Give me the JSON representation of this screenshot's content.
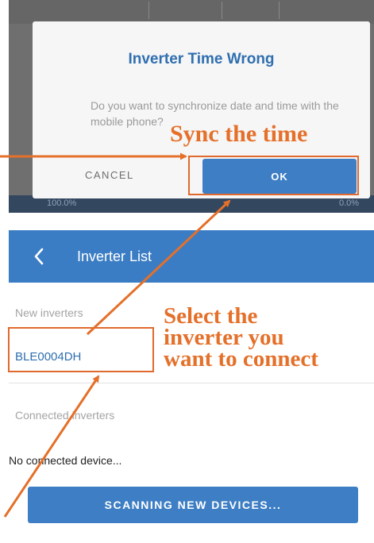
{
  "dialog": {
    "title": "Inverter Time Wrong",
    "message": "Do you want to synchronize date and time with the mobile phone?",
    "cancel_label": "CANCEL",
    "ok_label": "OK",
    "background_left": "100.0%",
    "background_right": "0.0%"
  },
  "inverter_list": {
    "title": "Inverter List",
    "new_section_label": "New inverters",
    "new_devices": [
      "BLE0004DH"
    ],
    "connected_section_label": "Connected inverters",
    "connected_empty_text": "No connected device...",
    "scan_button_label": "SCANNING NEW DEVICES..."
  },
  "annotations": {
    "sync_callout": "Sync the time",
    "select_callout": "Select the\ninverter you\nwant to connect"
  },
  "colors": {
    "accent_blue": "#3b7dc4",
    "annotation_orange": "#e4702a"
  }
}
